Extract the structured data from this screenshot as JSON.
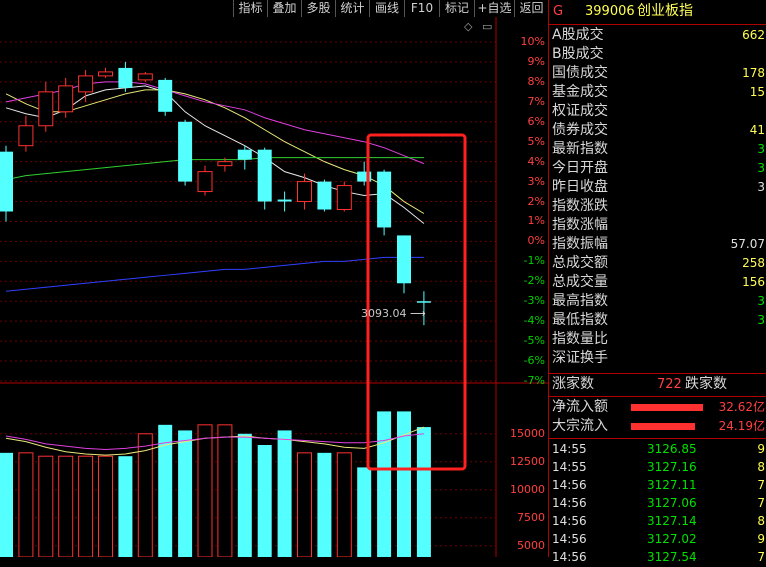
{
  "toolbar": {
    "buttons": [
      "指标",
      "叠加",
      "多股",
      "统计",
      "画线",
      "F10",
      "标记",
      "+自选",
      "返回"
    ]
  },
  "price_axis": {
    "ticks": [
      "10%",
      "9%",
      "8%",
      "7%",
      "6%",
      "5%",
      "4%",
      "3%",
      "2%",
      "1%",
      "0%",
      "-1%",
      "-2%",
      "-3%",
      "-4%",
      "-5%",
      "-6%",
      "-7%"
    ]
  },
  "volume_axis": {
    "ticks": [
      "15000",
      "12500",
      "10000",
      "7500",
      "5000"
    ]
  },
  "chart": {
    "low_annotation": "3093.04",
    "colors": {
      "up": "#ff3030",
      "down": "#54ffff",
      "ma_white": "#e8e8e8",
      "ma_yellow": "#e8e878",
      "ma_magenta": "#e040e0",
      "ma_green": "#30d030",
      "ma_blue": "#3040ff",
      "highlight_box": "#ff2020"
    }
  },
  "chart_data": {
    "type": "candlestick",
    "ylabel_unit": "%",
    "ylim": [
      -8,
      10.5
    ],
    "candles": [
      {
        "o": 1.5,
        "c": 4.5,
        "h": 4.8,
        "l": 1.0,
        "dir": "down"
      },
      {
        "o": 4.8,
        "c": 5.8,
        "h": 6.3,
        "l": 4.5,
        "dir": "up"
      },
      {
        "o": 5.8,
        "c": 7.5,
        "h": 8.0,
        "l": 5.5,
        "dir": "up"
      },
      {
        "o": 6.5,
        "c": 7.8,
        "h": 8.2,
        "l": 6.2,
        "dir": "up"
      },
      {
        "o": 7.5,
        "c": 8.3,
        "h": 8.6,
        "l": 7.0,
        "dir": "up"
      },
      {
        "o": 8.5,
        "c": 8.3,
        "h": 8.7,
        "l": 8.2,
        "dir": "up"
      },
      {
        "o": 8.7,
        "c": 7.7,
        "h": 9.0,
        "l": 7.5,
        "dir": "down"
      },
      {
        "o": 8.4,
        "c": 8.1,
        "h": 8.5,
        "l": 8.0,
        "dir": "up"
      },
      {
        "o": 8.1,
        "c": 6.5,
        "h": 8.2,
        "l": 6.3,
        "dir": "down"
      },
      {
        "o": 6.0,
        "c": 3.0,
        "h": 6.1,
        "l": 2.8,
        "dir": "down"
      },
      {
        "o": 2.5,
        "c": 3.5,
        "h": 3.8,
        "l": 2.3,
        "dir": "up"
      },
      {
        "o": 3.8,
        "c": 4.0,
        "h": 4.2,
        "l": 3.5,
        "dir": "up"
      },
      {
        "o": 4.6,
        "c": 4.1,
        "h": 4.8,
        "l": 3.6,
        "dir": "down"
      },
      {
        "o": 4.6,
        "c": 2.0,
        "h": 4.7,
        "l": 1.6,
        "dir": "down"
      },
      {
        "o": 2.1,
        "c": 2.0,
        "h": 2.5,
        "l": 1.5,
        "dir": "down"
      },
      {
        "o": 2.0,
        "c": 3.0,
        "h": 3.4,
        "l": 1.6,
        "dir": "up"
      },
      {
        "o": 3.0,
        "c": 1.6,
        "h": 3.1,
        "l": 1.5,
        "dir": "down"
      },
      {
        "o": 1.6,
        "c": 2.8,
        "h": 3.0,
        "l": 1.5,
        "dir": "up"
      },
      {
        "o": 3.5,
        "c": 3.0,
        "h": 4.0,
        "l": 2.8,
        "dir": "down"
      },
      {
        "o": 3.5,
        "c": 0.7,
        "h": 3.6,
        "l": 0.3,
        "dir": "down"
      },
      {
        "o": 0.3,
        "c": -2.1,
        "h": 0.3,
        "l": -2.6,
        "dir": "down"
      },
      {
        "o": -3.0,
        "c": -3.0,
        "h": -2.5,
        "l": -4.2,
        "dir": "down"
      }
    ],
    "volumes": [
      13300,
      13300,
      13000,
      13000,
      13000,
      13000,
      13000,
      15000,
      15800,
      15300,
      15800,
      15800,
      15000,
      14000,
      15300,
      13300,
      13300,
      13300,
      12000,
      17000,
      17000,
      15600
    ],
    "volume_ylim": [
      4000,
      19000
    ],
    "ma_lines": {
      "white": [
        6.7,
        6.4,
        6.2,
        6.6,
        7.3,
        7.6,
        7.7,
        7.8,
        7.5,
        6.5,
        5.8,
        5.3,
        4.8,
        4.2,
        3.5,
        3.2,
        2.8,
        2.5,
        2.3,
        2.4,
        1.7,
        0.9
      ],
      "yellow": [
        7.4,
        6.9,
        6.5,
        6.5,
        6.8,
        7.1,
        7.4,
        7.6,
        7.6,
        7.4,
        7.1,
        6.7,
        6.2,
        5.6,
        5.0,
        4.5,
        4.0,
        3.6,
        3.3,
        2.8,
        2.0,
        1.4
      ],
      "magenta": [
        7.0,
        7.2,
        7.4,
        7.6,
        7.9,
        8.0,
        8.0,
        7.9,
        7.6,
        7.3,
        7.0,
        6.8,
        6.6,
        6.2,
        5.9,
        5.6,
        5.4,
        5.2,
        5.0,
        4.7,
        4.3,
        3.9
      ],
      "green": [
        3.1,
        3.3,
        3.4,
        3.5,
        3.6,
        3.7,
        3.8,
        3.9,
        4.0,
        4.1,
        4.1,
        4.1,
        4.1,
        4.2,
        4.2,
        4.2,
        4.2,
        4.2,
        4.2,
        4.2,
        4.2,
        4.2
      ],
      "blue": [
        -2.5,
        -2.4,
        -2.3,
        -2.2,
        -2.1,
        -2.0,
        -1.9,
        -1.8,
        -1.7,
        -1.6,
        -1.5,
        -1.4,
        -1.4,
        -1.3,
        -1.2,
        -1.1,
        -1.0,
        -1.0,
        -0.9,
        -0.8,
        -0.8,
        -0.8
      ]
    },
    "vol_ma": {
      "yellow": [
        14600,
        14300,
        13800,
        13400,
        13200,
        13100,
        13200,
        13500,
        14000,
        14300,
        14600,
        14700,
        14800,
        14600,
        14500,
        14300,
        14100,
        13800,
        13700,
        14200,
        14900,
        15600
      ],
      "magenta": [
        14800,
        14500,
        14100,
        13900,
        13700,
        13600,
        13700,
        13900,
        14200,
        14400,
        14600,
        14700,
        14700,
        14600,
        14500,
        14400,
        14300,
        14200,
        14200,
        14400,
        14800,
        15000
      ]
    }
  },
  "right_panel": {
    "header": {
      "code_prefix": "G",
      "code": "399006",
      "name": "创业板指"
    },
    "rows": [
      {
        "label": "A股成交",
        "value": "662",
        "color": "yellow"
      },
      {
        "label": "B股成交",
        "value": "",
        "color": "yellow"
      },
      {
        "label": "国债成交",
        "value": "178",
        "color": "yellow"
      },
      {
        "label": "基金成交",
        "value": "15",
        "color": "yellow"
      },
      {
        "label": "权证成交",
        "value": "",
        "color": "yellow"
      },
      {
        "label": "债券成交",
        "value": "41",
        "color": "yellow"
      },
      {
        "label": "最新指数",
        "value": "3",
        "color": "green"
      },
      {
        "label": "今日开盘",
        "value": "3",
        "color": "green"
      },
      {
        "label": "昨日收盘",
        "value": "3",
        "color": "white"
      },
      {
        "label": "指数涨跌",
        "value": "",
        "color": "green"
      },
      {
        "label": "指数涨幅",
        "value": "",
        "color": "green"
      },
      {
        "label": "指数振幅",
        "value": "57.07",
        "color": "white"
      },
      {
        "label": "总成交额",
        "value": "258",
        "color": "yellow"
      },
      {
        "label": "总成交量",
        "value": "156",
        "color": "yellow"
      },
      {
        "label": "最高指数",
        "value": "3",
        "color": "green"
      },
      {
        "label": "最低指数",
        "value": "3",
        "color": "green"
      },
      {
        "label": "指数量比",
        "value": "",
        "color": "white"
      },
      {
        "label": "深证换手",
        "value": "",
        "color": "white"
      }
    ],
    "breadth": {
      "up_label": "涨家数",
      "up_value": "722",
      "down_label": "跌家数"
    },
    "flows": [
      {
        "label": "净流入额",
        "value": "32.62亿",
        "bar_fraction": 0.9
      },
      {
        "label": "大宗流入",
        "value": "24.19亿",
        "bar_fraction": 0.8
      }
    ],
    "ticks": [
      {
        "time": "14:55",
        "price": "3126.85",
        "extra": "9"
      },
      {
        "time": "14:55",
        "price": "3127.16",
        "extra": "8"
      },
      {
        "time": "14:56",
        "price": "3127.11",
        "extra": "7"
      },
      {
        "time": "14:56",
        "price": "3127.06",
        "extra": "7"
      },
      {
        "time": "14:56",
        "price": "3127.14",
        "extra": "8"
      },
      {
        "time": "14:56",
        "price": "3127.02",
        "extra": "9"
      },
      {
        "time": "14:56",
        "price": "3127.54",
        "extra": "7"
      }
    ]
  }
}
